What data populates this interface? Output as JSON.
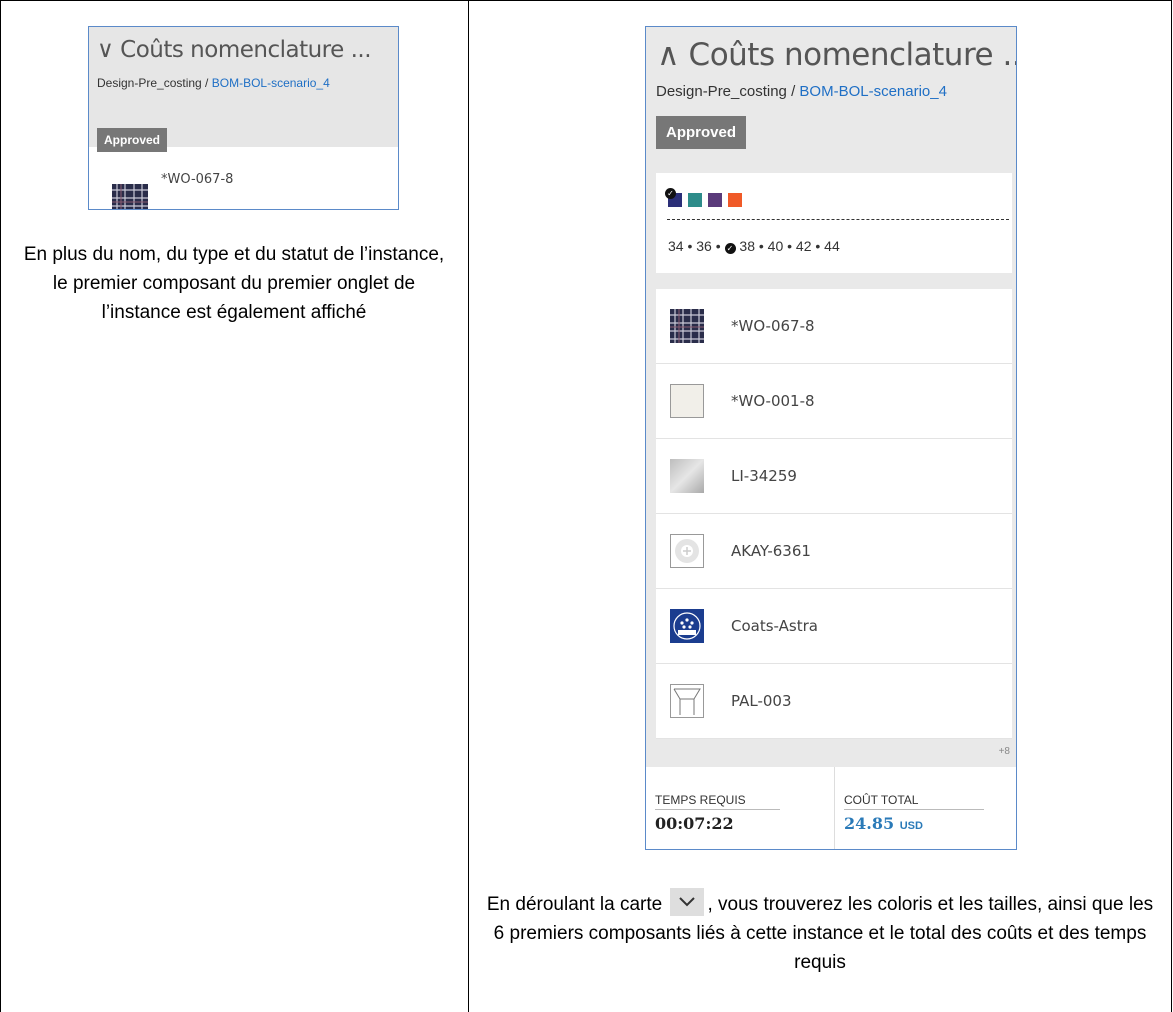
{
  "left_card": {
    "title": "∨ Coûts nomenclature ...",
    "breadcrumb_prefix": "Design-Pre_costing / ",
    "breadcrumb_link": "BOM-BOL-scenario_4",
    "status": "Approved",
    "first_component": "*WO-067-8"
  },
  "left_caption": "En plus du nom, du type et du statut de l’instance, le premier composant du premier onglet de l’instance est également affiché",
  "right_card": {
    "title": "∧ Coûts nomenclature ...",
    "breadcrumb_prefix": "Design-Pre_costing / ",
    "breadcrumb_link": "BOM-BOL-scenario_4",
    "status": "Approved",
    "colorways": [
      "#2b2f78",
      "#2e8c8a",
      "#5a3a7a",
      "#f05a28"
    ],
    "sizes_before": "34 • 36 • ",
    "sizes_selected": "38",
    "sizes_after": " • 40 • 42 • 44",
    "components": [
      {
        "label": "*WO-067-8",
        "icon": "plaid-fabric-icon"
      },
      {
        "label": "*WO-001-8",
        "icon": "plain-fabric-icon"
      },
      {
        "label": "LI-34259",
        "icon": "lining-icon"
      },
      {
        "label": "AKAY-6361",
        "icon": "button-icon"
      },
      {
        "label": "Coats-Astra",
        "icon": "coats-logo-icon"
      },
      {
        "label": "PAL-003",
        "icon": "packaging-icon"
      }
    ],
    "more_count": "+8",
    "time_label": "TEMPS REQUIS",
    "time_value": "00:07:22",
    "cost_label": "COÛT TOTAL",
    "cost_value": "24.85",
    "cost_unit": "USD"
  },
  "right_caption_before": "En déroulant la carte",
  "right_caption_after": ", vous trouverez les coloris et les tailles, ainsi que les 6 premiers composants liés à cette instance et le total des coûts et des temps requis"
}
